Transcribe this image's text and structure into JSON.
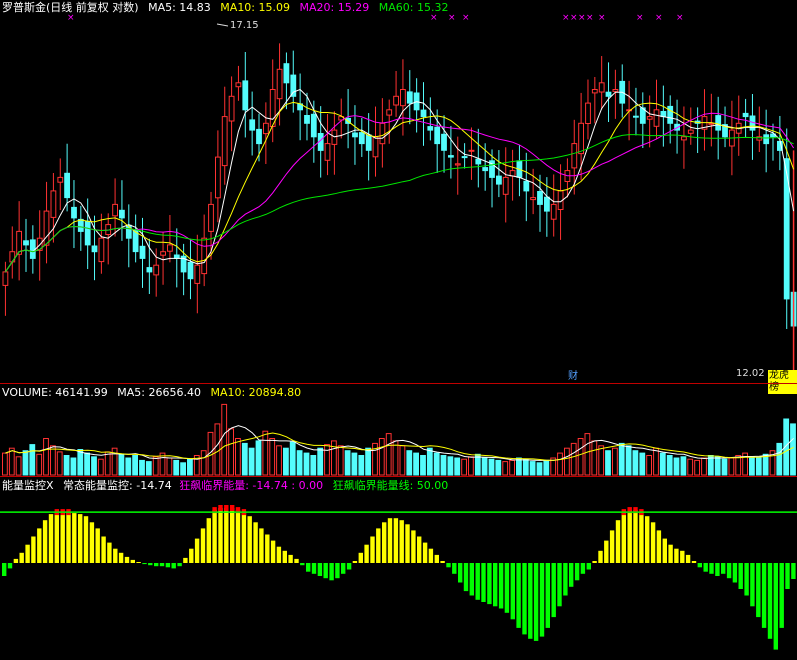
{
  "price_header": {
    "title": "罗普斯金(日线 前复权 对数)",
    "ma5": "MA5: 14.83",
    "ma10": "MA10: 15.09",
    "ma20": "MA20: 15.29",
    "ma60": "MA60: 15.32"
  },
  "high_label": "17.15",
  "low_label": "12.02",
  "badge_finance": "财",
  "badge_list": "龙虎榜",
  "volume_header": {
    "label": "VOLUME: 46141.99",
    "ma5": "MA5: 26656.40",
    "ma10": "MA10: 20894.80"
  },
  "energy_header": {
    "name": "能量监控X",
    "normal": "常态能量监控: -14.74",
    "frenzy": "狂飙临界能量: -14.74",
    "frenzy_zero": ": 0.00",
    "line": "狂飙临界能量线: 50.00"
  },
  "colors": {
    "up": "#ff3232",
    "down": "#54fcfc",
    "ma5": "#ffffff",
    "ma10": "#ffff00",
    "ma20": "#ff00ff",
    "ma60": "#00e600",
    "energy_pos": "#ffff00",
    "energy_neg": "#00ff00",
    "energy_top": "#ff0000",
    "threshold": "#00ff00",
    "divider": "#c00000"
  },
  "chart_data": [
    {
      "type": "candlestick",
      "title": "罗普斯金(日线 前复权 对数)",
      "series": [
        {
          "name": "MA5",
          "value": 14.83
        },
        {
          "name": "MA10",
          "value": 15.09
        },
        {
          "name": "MA20",
          "value": 15.29
        },
        {
          "name": "MA60",
          "value": 15.32
        }
      ],
      "annotations": [
        {
          "text": "17.15",
          "kind": "period-high"
        },
        {
          "text": "12.02",
          "kind": "period-low"
        }
      ],
      "closes": [
        13.6,
        13.9,
        14.2,
        14.0,
        13.8,
        14.1,
        14.5,
        14.8,
        15.0,
        14.7,
        14.4,
        14.2,
        14.0,
        13.9,
        14.1,
        14.3,
        14.6,
        14.4,
        14.1,
        13.9,
        13.8,
        13.6,
        13.7,
        13.9,
        14.0,
        13.8,
        13.6,
        13.5,
        13.7,
        14.1,
        14.6,
        15.3,
        15.9,
        16.2,
        16.4,
        16.0,
        15.7,
        15.5,
        15.8,
        16.3,
        16.6,
        16.4,
        16.2,
        16.0,
        15.8,
        15.6,
        15.4,
        15.5,
        15.7,
        15.9,
        15.8,
        15.6,
        15.5,
        15.4,
        15.6,
        15.8,
        16.0,
        16.2,
        16.3,
        16.1,
        16.0,
        15.9,
        15.7,
        15.5,
        15.4,
        15.3,
        15.2,
        15.3,
        15.4,
        15.2,
        15.1,
        15.0,
        14.9,
        15.0,
        15.1,
        15.0,
        14.8,
        14.7,
        14.6,
        14.5,
        14.6,
        14.8,
        15.1,
        15.5,
        15.8,
        16.1,
        16.3,
        16.4,
        16.2,
        16.3,
        16.1,
        16.0,
        15.9,
        15.8,
        15.9,
        16.0,
        15.9,
        15.8,
        15.7,
        15.6,
        15.7,
        15.8,
        15.9,
        15.8,
        15.7,
        15.6,
        15.7,
        15.8,
        15.9,
        15.7,
        15.6,
        15.5,
        15.6,
        15.4,
        13.2,
        12.8
      ]
    },
    {
      "type": "bar",
      "title": "VOLUME",
      "series": [
        {
          "name": "VOLUME",
          "value": 46141.99
        },
        {
          "name": "MA5",
          "value": 26656.4
        },
        {
          "name": "MA10",
          "value": 20894.8
        }
      ],
      "values": [
        18,
        22,
        15,
        20,
        25,
        17,
        30,
        24,
        19,
        16,
        14,
        21,
        18,
        15,
        13,
        19,
        22,
        17,
        14,
        16,
        12,
        11,
        15,
        18,
        14,
        12,
        10,
        13,
        16,
        20,
        35,
        42,
        58,
        38,
        30,
        26,
        22,
        28,
        36,
        30,
        24,
        22,
        27,
        20,
        18,
        16,
        22,
        25,
        28,
        24,
        20,
        18,
        16,
        22,
        26,
        30,
        34,
        28,
        24,
        20,
        18,
        16,
        22,
        18,
        16,
        15,
        14,
        13,
        15,
        17,
        14,
        13,
        12,
        11,
        12,
        14,
        13,
        11,
        10,
        12,
        14,
        18,
        22,
        26,
        30,
        34,
        28,
        24,
        20,
        22,
        26,
        24,
        20,
        18,
        16,
        22,
        18,
        16,
        14,
        15,
        13,
        12,
        14,
        16,
        15,
        13,
        14,
        16,
        18,
        15,
        14,
        17,
        20,
        26,
        46,
        42
      ]
    },
    {
      "type": "bar",
      "title": "能量监控X",
      "series": [
        {
          "name": "常态能量监控",
          "value": -14.74
        },
        {
          "name": "狂飙临界能量",
          "value": -14.74
        },
        {
          "name": "狂飙临界能量线",
          "value": 50.0
        }
      ],
      "threshold": 50.0,
      "values": [
        -12,
        -5,
        4,
        10,
        18,
        26,
        34,
        42,
        48,
        50,
        50,
        50,
        49,
        48,
        46,
        40,
        34,
        26,
        20,
        14,
        10,
        6,
        3,
        1,
        -1,
        -2,
        -3,
        -3,
        -4,
        -5,
        -3,
        5,
        14,
        24,
        34,
        44,
        52,
        54,
        54,
        54,
        52,
        50,
        46,
        40,
        34,
        28,
        22,
        16,
        12,
        8,
        4,
        -2,
        -8,
        -10,
        -12,
        -14,
        -16,
        -14,
        -10,
        -6,
        2,
        10,
        18,
        26,
        34,
        40,
        44,
        44,
        42,
        38,
        32,
        26,
        20,
        14,
        8,
        2,
        -4,
        -10,
        -18,
        -26,
        -30,
        -34,
        -36,
        -38,
        -40,
        -42,
        -46,
        -52,
        -60,
        -66,
        -70,
        -72,
        -68,
        -60,
        -50,
        -40,
        -30,
        -22,
        -16,
        -10,
        -6,
        2,
        12,
        22,
        32,
        42,
        50,
        52,
        52,
        50,
        46,
        40,
        32,
        24,
        18,
        14,
        12,
        8,
        2,
        -4,
        -8,
        -10,
        -12,
        -10,
        -14,
        -18,
        -24,
        -30,
        -40,
        -50,
        -60,
        -70,
        -80,
        -60,
        -24,
        -14.74
      ]
    }
  ]
}
